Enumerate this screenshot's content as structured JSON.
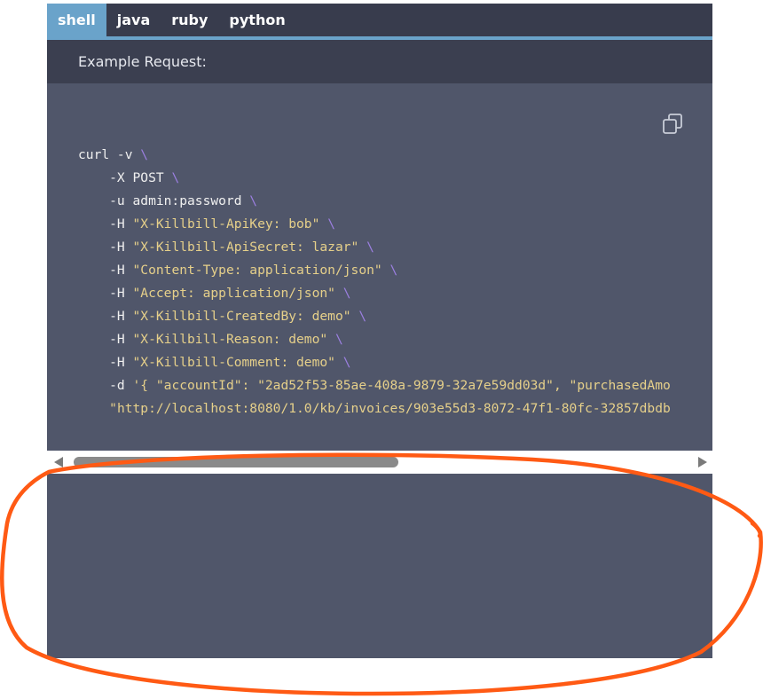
{
  "tabs": [
    {
      "label": "shell",
      "active": true
    },
    {
      "label": "java",
      "active": false
    },
    {
      "label": "ruby",
      "active": false
    },
    {
      "label": "python",
      "active": false
    }
  ],
  "example_request_label": "Example Request:",
  "copy_icon": "copy-icon",
  "code_lines": [
    [
      {
        "t": "plain",
        "s": "curl -v "
      },
      {
        "t": "esc",
        "s": "\\"
      }
    ],
    [
      {
        "t": "plain",
        "s": "    -X POST "
      },
      {
        "t": "esc",
        "s": "\\"
      }
    ],
    [
      {
        "t": "plain",
        "s": "    -u admin:password "
      },
      {
        "t": "esc",
        "s": "\\"
      }
    ],
    [
      {
        "t": "plain",
        "s": "    -H "
      },
      {
        "t": "str",
        "s": "\"X-Killbill-ApiKey: bob\""
      },
      {
        "t": "plain",
        "s": " "
      },
      {
        "t": "esc",
        "s": "\\"
      }
    ],
    [
      {
        "t": "plain",
        "s": "    -H "
      },
      {
        "t": "str",
        "s": "\"X-Killbill-ApiSecret: lazar\""
      },
      {
        "t": "plain",
        "s": " "
      },
      {
        "t": "esc",
        "s": "\\"
      }
    ],
    [
      {
        "t": "plain",
        "s": "    -H "
      },
      {
        "t": "str",
        "s": "\"Content-Type: application/json\""
      },
      {
        "t": "plain",
        "s": " "
      },
      {
        "t": "esc",
        "s": "\\"
      }
    ],
    [
      {
        "t": "plain",
        "s": "    -H "
      },
      {
        "t": "str",
        "s": "\"Accept: application/json\""
      },
      {
        "t": "plain",
        "s": " "
      },
      {
        "t": "esc",
        "s": "\\"
      }
    ],
    [
      {
        "t": "plain",
        "s": "    -H "
      },
      {
        "t": "str",
        "s": "\"X-Killbill-CreatedBy: demo\""
      },
      {
        "t": "plain",
        "s": " "
      },
      {
        "t": "esc",
        "s": "\\"
      }
    ],
    [
      {
        "t": "plain",
        "s": "    -H "
      },
      {
        "t": "str",
        "s": "\"X-Killbill-Reason: demo\""
      },
      {
        "t": "plain",
        "s": " "
      },
      {
        "t": "esc",
        "s": "\\"
      }
    ],
    [
      {
        "t": "plain",
        "s": "    -H "
      },
      {
        "t": "str",
        "s": "\"X-Killbill-Comment: demo\""
      },
      {
        "t": "plain",
        "s": " "
      },
      {
        "t": "esc",
        "s": "\\"
      }
    ],
    [
      {
        "t": "plain",
        "s": "    -d "
      },
      {
        "t": "str",
        "s": "'{ \"accountId\": \"2ad52f53-85ae-408a-9879-32a7e59dd03d\", \"purchasedAmo"
      }
    ],
    [
      {
        "t": "plain",
        "s": "    "
      },
      {
        "t": "str",
        "s": "\"http://localhost:8080/1.0/kb/invoices/903e55d3-8072-47f1-80fc-32857dbdb"
      }
    ]
  ],
  "scroll_position": 0.52,
  "colors": {
    "tab_active": "#6aa3ca",
    "tabbar_bg": "#383c4d",
    "code_bg": "#50566a",
    "string": "#e6d08a",
    "escape": "#9b7fe0",
    "annotation": "#ff5a14"
  }
}
